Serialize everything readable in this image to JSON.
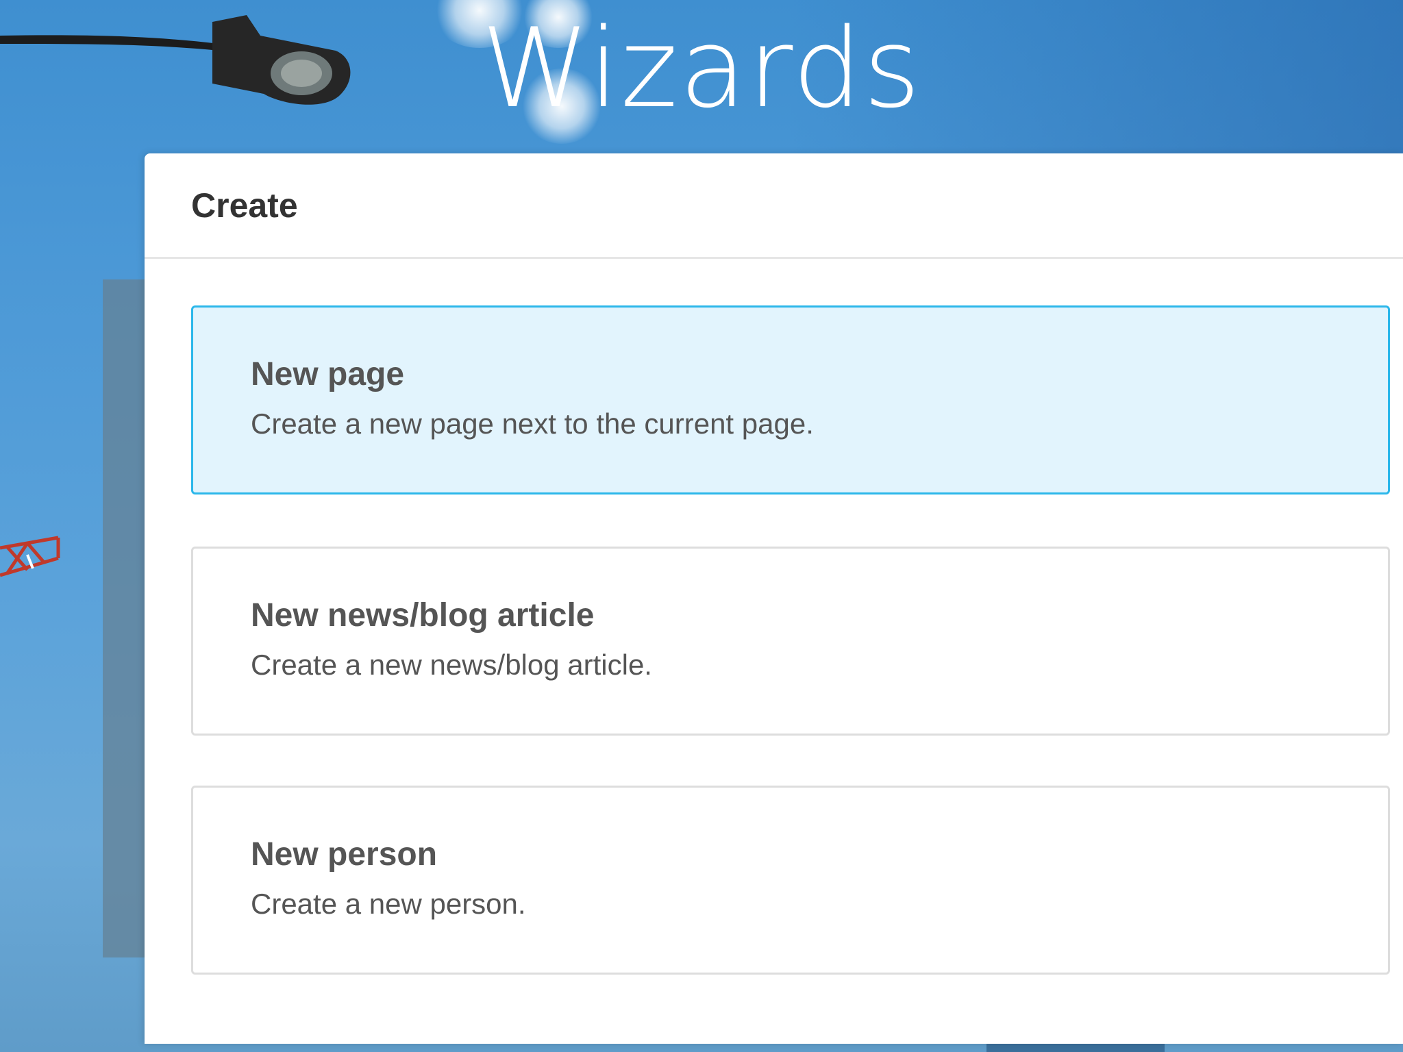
{
  "slide": {
    "title": "Wizards"
  },
  "dialog": {
    "title": "Create",
    "options": [
      {
        "title": "New page",
        "description": "Create a new page next to the current page.",
        "selected": true
      },
      {
        "title": "New news/blog article",
        "description": "Create a new news/blog article.",
        "selected": false
      },
      {
        "title": "New person",
        "description": "Create a new person.",
        "selected": false
      }
    ]
  },
  "colors": {
    "selected_background": "#e2f4fd",
    "selected_border": "#2bb7ea",
    "text": "#555555",
    "header_text": "#333333"
  }
}
